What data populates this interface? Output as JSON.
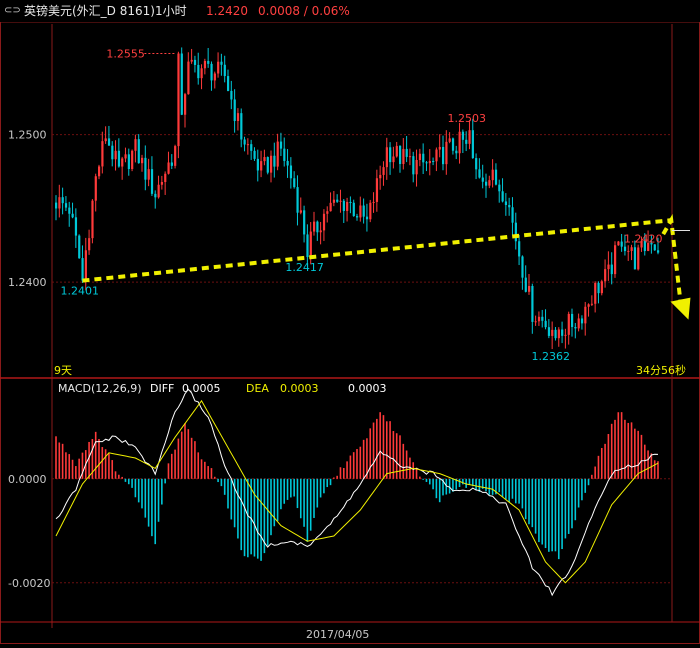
{
  "header": {
    "instrument": "英镑美元(外汇_D 8161)1小时",
    "last_price": "1.2420",
    "change": "0.0008 / 0.06%"
  },
  "colors": {
    "up": "#ff3a3a",
    "down": "#00c8d8",
    "yellow": "#f0f000",
    "grid": "#6b0f0f",
    "axis_text": "#c8c8c8",
    "white": "#ffffff"
  },
  "main": {
    "period_label": "9天",
    "countdown": "34分56秒",
    "y_ticks": [
      "1.2500",
      "1.2400"
    ],
    "annotations": {
      "high": "1.2555",
      "peak2": "1.2503",
      "low1": "1.2401",
      "low2": "1.2417",
      "low3": "1.2362",
      "last": "1.2420"
    }
  },
  "macd": {
    "label": "MACD(12,26,9)",
    "diff_label": "DIFF",
    "diff_value": "0.0005",
    "dea_label": "DEA",
    "dea_value": "0.0003",
    "macd_value": "0.0003",
    "y_ticks": [
      "0.0000",
      "-0.0020"
    ]
  },
  "x_axis": {
    "date_label": "2017/04/05"
  },
  "chart_data": [
    {
      "type": "candlestick",
      "title": "英镑美元(外汇_D 8161)1小时",
      "ylim": [
        1.2335,
        1.2575
      ],
      "y_ticks": [
        1.25,
        1.24
      ],
      "anchors": [
        {
          "bar": 0,
          "price": 1.2455
        },
        {
          "bar": 4,
          "price": 1.245
        },
        {
          "bar": 8,
          "price": 1.2405
        },
        {
          "bar": 12,
          "price": 1.247
        },
        {
          "bar": 15,
          "price": 1.25
        },
        {
          "bar": 19,
          "price": 1.2475
        },
        {
          "bar": 24,
          "price": 1.249
        },
        {
          "bar": 30,
          "price": 1.246
        },
        {
          "bar": 36,
          "price": 1.249
        },
        {
          "bar": 40,
          "price": 1.2545
        },
        {
          "bar": 45,
          "price": 1.2545
        },
        {
          "bar": 51,
          "price": 1.254
        },
        {
          "bar": 56,
          "price": 1.25
        },
        {
          "bar": 62,
          "price": 1.2475
        },
        {
          "bar": 68,
          "price": 1.249
        },
        {
          "bar": 72,
          "price": 1.2465
        },
        {
          "bar": 76,
          "price": 1.2425
        },
        {
          "bar": 82,
          "price": 1.245
        },
        {
          "bar": 88,
          "price": 1.2455
        },
        {
          "bar": 94,
          "price": 1.244
        },
        {
          "bar": 100,
          "price": 1.249
        },
        {
          "bar": 108,
          "price": 1.248
        },
        {
          "bar": 114,
          "price": 1.248
        },
        {
          "bar": 118,
          "price": 1.249
        },
        {
          "bar": 123,
          "price": 1.2495
        },
        {
          "bar": 127,
          "price": 1.2475
        },
        {
          "bar": 132,
          "price": 1.247
        },
        {
          "bar": 136,
          "price": 1.246
        },
        {
          "bar": 140,
          "price": 1.242
        },
        {
          "bar": 144,
          "price": 1.238
        },
        {
          "bar": 149,
          "price": 1.237
        },
        {
          "bar": 153,
          "price": 1.2368
        },
        {
          "bar": 158,
          "price": 1.2375
        },
        {
          "bar": 163,
          "price": 1.2395
        },
        {
          "bar": 167,
          "price": 1.2405
        },
        {
          "bar": 171,
          "price": 1.243
        },
        {
          "bar": 175,
          "price": 1.2415
        },
        {
          "bar": 180,
          "price": 1.243
        },
        {
          "bar": 182,
          "price": 1.242
        }
      ],
      "labeled_extremes": [
        {
          "bar": 37,
          "price": 1.2555
        },
        {
          "bar": 125,
          "price": 1.2503
        },
        {
          "bar": 8,
          "price": 1.2401
        },
        {
          "bar": 76,
          "price": 1.2417
        },
        {
          "bar": 151,
          "price": 1.2362
        },
        {
          "bar": 182,
          "price": 1.242
        }
      ],
      "trendline": {
        "from": {
          "bar": 8,
          "price": 1.2401
        },
        "to": {
          "bar": 186,
          "price": 1.2442
        }
      },
      "projection": [
        {
          "bar": 186,
          "price": 1.2442
        },
        {
          "bar": 190,
          "price": 1.238
        }
      ]
    },
    {
      "type": "macd",
      "title": "MACD(12,26,9)",
      "ylim": [
        -0.0026,
        0.0019
      ],
      "y_ticks": [
        0.0,
        -0.002
      ],
      "histogram_anchors": [
        {
          "bar": 0,
          "value": 0.0008
        },
        {
          "bar": 6,
          "value": 0.0003
        },
        {
          "bar": 12,
          "value": 0.0009
        },
        {
          "bar": 18,
          "value": 0.0002
        },
        {
          "bar": 24,
          "value": -0.0003
        },
        {
          "bar": 30,
          "value": -0.0012
        },
        {
          "bar": 34,
          "value": 0.0003
        },
        {
          "bar": 39,
          "value": 0.0011
        },
        {
          "bar": 44,
          "value": 0.0004
        },
        {
          "bar": 50,
          "value": -0.0001
        },
        {
          "bar": 56,
          "value": -0.0014
        },
        {
          "bar": 62,
          "value": -0.0016
        },
        {
          "bar": 68,
          "value": -0.0006
        },
        {
          "bar": 72,
          "value": -0.0003
        },
        {
          "bar": 76,
          "value": -0.0012
        },
        {
          "bar": 80,
          "value": -0.0004
        },
        {
          "bar": 86,
          "value": 0.0002
        },
        {
          "bar": 92,
          "value": 0.0006
        },
        {
          "bar": 98,
          "value": 0.0013
        },
        {
          "bar": 104,
          "value": 0.0008
        },
        {
          "bar": 110,
          "value": 0.0001
        },
        {
          "bar": 116,
          "value": -0.0004
        },
        {
          "bar": 122,
          "value": -0.0001
        },
        {
          "bar": 128,
          "value": -0.0002
        },
        {
          "bar": 134,
          "value": -0.0003
        },
        {
          "bar": 140,
          "value": -0.0005
        },
        {
          "bar": 146,
          "value": -0.0012
        },
        {
          "bar": 152,
          "value": -0.0015
        },
        {
          "bar": 158,
          "value": -0.0006
        },
        {
          "bar": 164,
          "value": 0.0004
        },
        {
          "bar": 170,
          "value": 0.0013
        },
        {
          "bar": 176,
          "value": 0.0009
        },
        {
          "bar": 182,
          "value": 0.0003
        }
      ],
      "diff_anchors": [
        {
          "bar": 0,
          "value": -0.0008
        },
        {
          "bar": 6,
          "value": -0.0002
        },
        {
          "bar": 12,
          "value": 0.0007
        },
        {
          "bar": 18,
          "value": 0.0008
        },
        {
          "bar": 24,
          "value": 0.0006
        },
        {
          "bar": 30,
          "value": 0.0001
        },
        {
          "bar": 36,
          "value": 0.0013
        },
        {
          "bar": 40,
          "value": 0.0017
        },
        {
          "bar": 46,
          "value": 0.0012
        },
        {
          "bar": 52,
          "value": 0.0001
        },
        {
          "bar": 58,
          "value": -0.0007
        },
        {
          "bar": 64,
          "value": -0.0013
        },
        {
          "bar": 70,
          "value": -0.0012
        },
        {
          "bar": 76,
          "value": -0.0013
        },
        {
          "bar": 84,
          "value": -0.0008
        },
        {
          "bar": 92,
          "value": -0.0001
        },
        {
          "bar": 98,
          "value": 0.0005
        },
        {
          "bar": 106,
          "value": 0.0002
        },
        {
          "bar": 114,
          "value": 0.0001
        },
        {
          "bar": 120,
          "value": -0.0002
        },
        {
          "bar": 128,
          "value": -0.0002
        },
        {
          "bar": 136,
          "value": -0.0005
        },
        {
          "bar": 144,
          "value": -0.0017
        },
        {
          "bar": 150,
          "value": -0.0022
        },
        {
          "bar": 156,
          "value": -0.0017
        },
        {
          "bar": 162,
          "value": -0.0007
        },
        {
          "bar": 168,
          "value": 0.0001
        },
        {
          "bar": 176,
          "value": 0.0003
        },
        {
          "bar": 182,
          "value": 0.0005
        }
      ],
      "dea_anchors": [
        {
          "bar": 0,
          "value": -0.0011
        },
        {
          "bar": 8,
          "value": -0.0001
        },
        {
          "bar": 16,
          "value": 0.0005
        },
        {
          "bar": 24,
          "value": 0.0004
        },
        {
          "bar": 30,
          "value": 0.0002
        },
        {
          "bar": 36,
          "value": 0.0008
        },
        {
          "bar": 44,
          "value": 0.0015
        },
        {
          "bar": 52,
          "value": 0.0006
        },
        {
          "bar": 60,
          "value": -0.0003
        },
        {
          "bar": 68,
          "value": -0.0009
        },
        {
          "bar": 76,
          "value": -0.0012
        },
        {
          "bar": 84,
          "value": -0.0011
        },
        {
          "bar": 92,
          "value": -0.0006
        },
        {
          "bar": 100,
          "value": 0.0001
        },
        {
          "bar": 108,
          "value": 0.0002
        },
        {
          "bar": 116,
          "value": 0.0001
        },
        {
          "bar": 124,
          "value": -0.0001
        },
        {
          "bar": 132,
          "value": -0.0002
        },
        {
          "bar": 140,
          "value": -0.0006
        },
        {
          "bar": 148,
          "value": -0.0016
        },
        {
          "bar": 154,
          "value": -0.002
        },
        {
          "bar": 160,
          "value": -0.0016
        },
        {
          "bar": 168,
          "value": -0.0005
        },
        {
          "bar": 176,
          "value": 0.0001
        },
        {
          "bar": 182,
          "value": 0.0003
        }
      ]
    }
  ]
}
